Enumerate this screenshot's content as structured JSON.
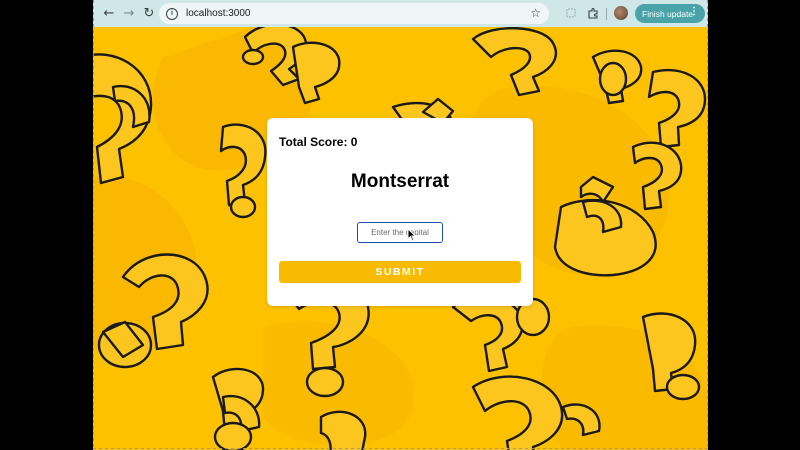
{
  "browser": {
    "url": "localhost:3000",
    "update_label": "Finish update",
    "update_menu": "⋮",
    "back_icon": "←",
    "forward_icon": "→",
    "reload_icon": "↻",
    "star_icon": "☆",
    "site_info_icon": "i"
  },
  "quiz": {
    "score_label": "Total Score: 0",
    "country": "Montserrat",
    "answer_placeholder": "Enter the capital",
    "submit_label": "SUBMIT"
  },
  "colors": {
    "background": "#fdc100",
    "submit": "#f9bb02",
    "chrome": "#cfe7e9",
    "update_button": "#4aa3a9"
  }
}
